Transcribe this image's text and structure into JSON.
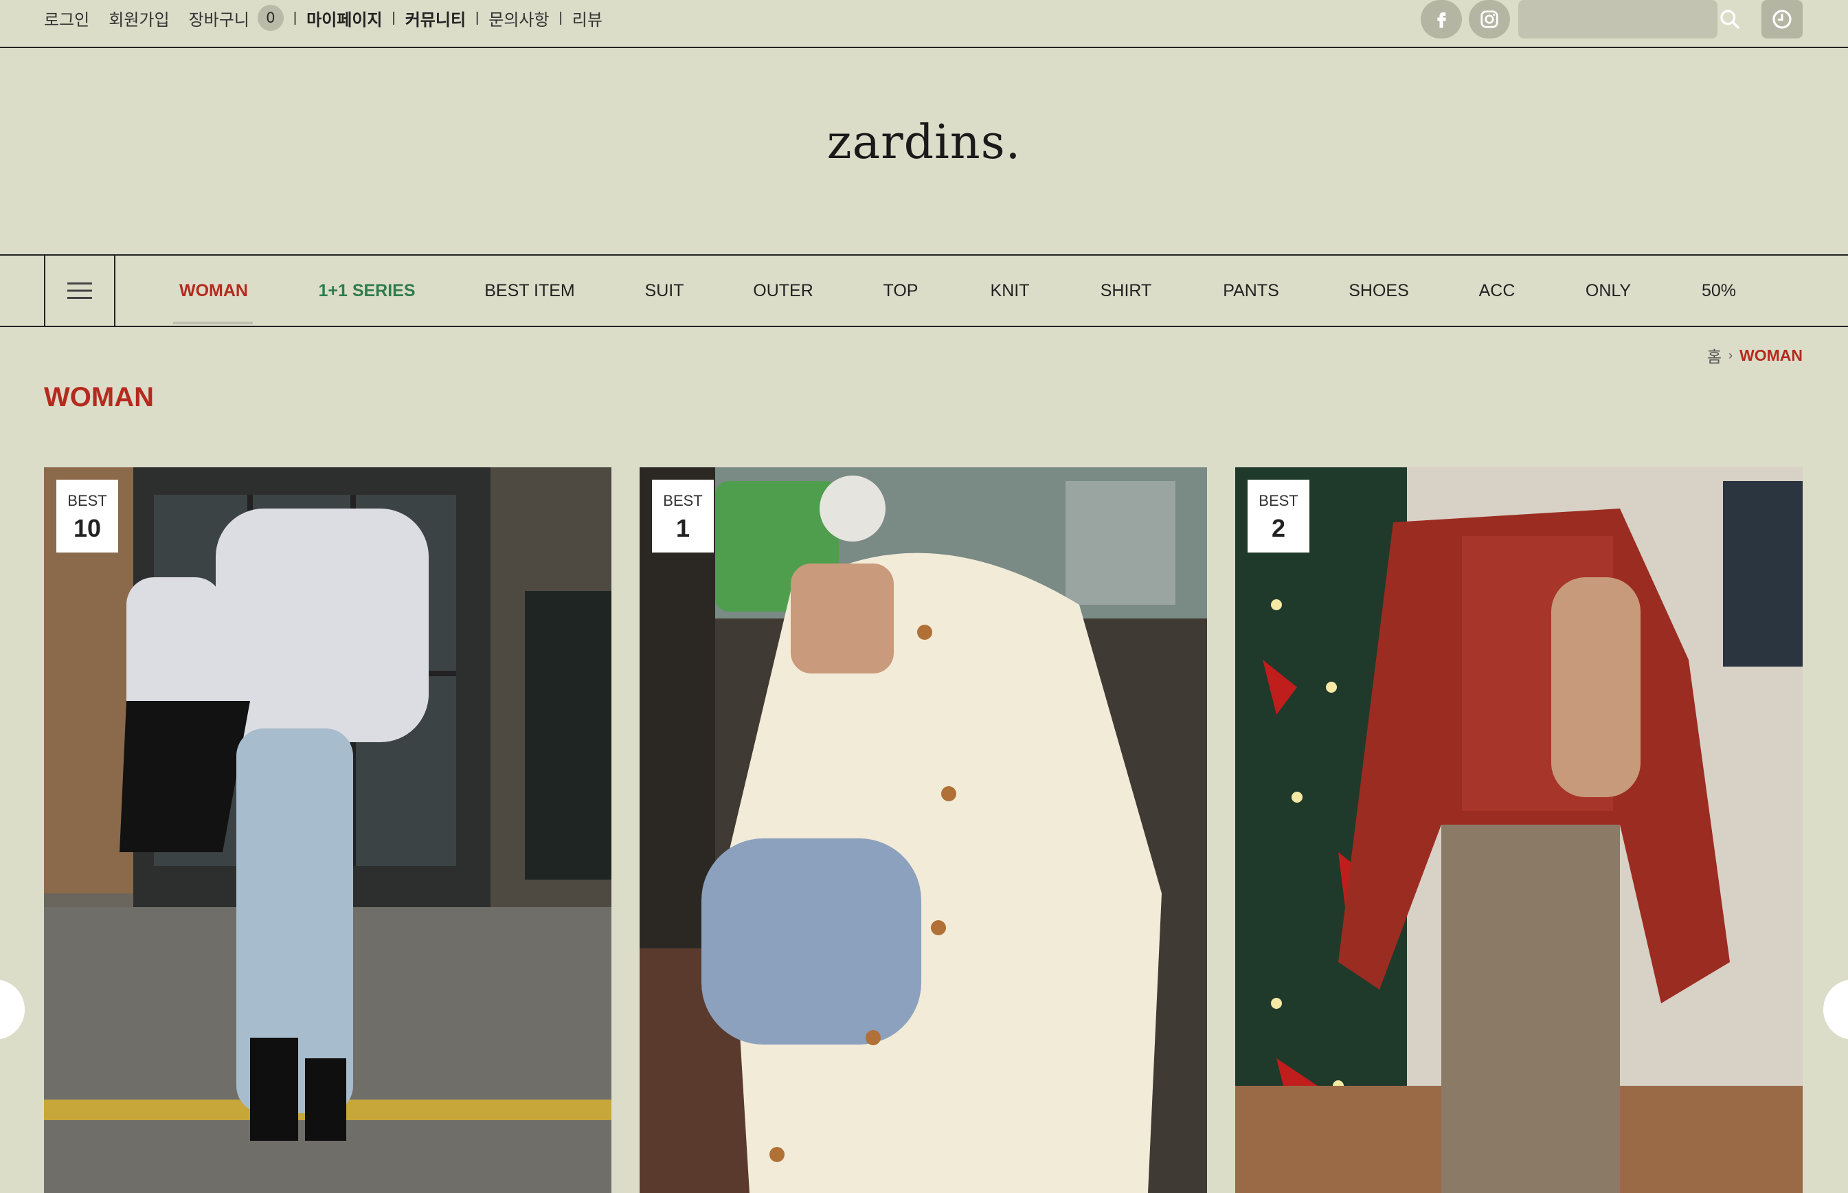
{
  "top_links": {
    "login": "로그인",
    "join": "회원가입",
    "cart": "장바구니",
    "cart_count": "0",
    "mypage": "마이페이지",
    "community": "커뮤니티",
    "inquiry": "문의사항",
    "review": "리뷰",
    "separator": "|"
  },
  "header_icons": {
    "facebook": "facebook-icon",
    "instagram": "instagram-icon",
    "search": "search-icon",
    "recent": "clock-icon"
  },
  "search": {
    "value": ""
  },
  "logo": {
    "text": "zardins."
  },
  "nav": {
    "items": [
      "WOMAN",
      "1+1 SERIES",
      "BEST ITEM",
      "SUIT",
      "OUTER",
      "TOP",
      "KNIT",
      "SHIRT",
      "PANTS",
      "SHOES",
      "ACC",
      "ONLY",
      "50%"
    ],
    "active": "WOMAN"
  },
  "breadcrumb": {
    "home": "홈",
    "current": "WOMAN"
  },
  "page": {
    "title": "WOMAN"
  },
  "products": [
    {
      "badge_label": "BEST",
      "rank": "10"
    },
    {
      "badge_label": "BEST",
      "rank": "1"
    },
    {
      "badge_label": "BEST",
      "rank": "2"
    }
  ],
  "colors": {
    "background": "#dcddc9",
    "accent_red": "#b52a1e",
    "accent_green": "#2f7d4a"
  }
}
